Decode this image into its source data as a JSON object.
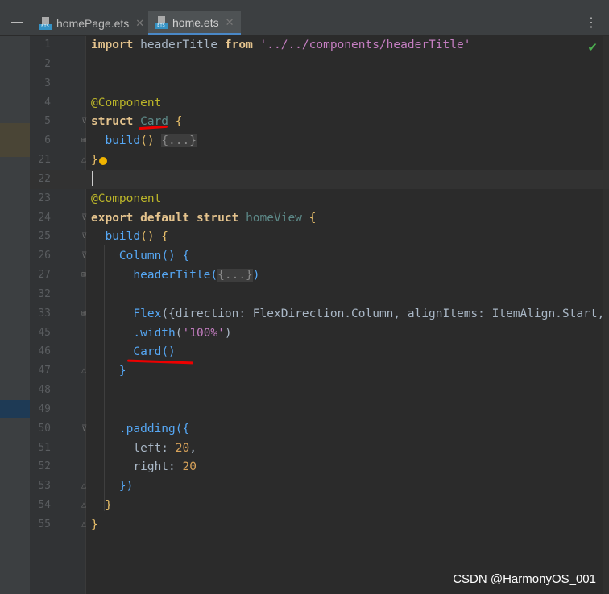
{
  "tabs": [
    {
      "label": "homePage.ets",
      "active": false
    },
    {
      "label": "home.ets",
      "active": true
    }
  ],
  "file_icon_label": "ETS",
  "status_icon": "check-icon",
  "watermark": "CSDN @HarmonyOS_001",
  "lines": [
    {
      "n": "1",
      "tokens": [
        [
          "import ",
          "kw"
        ],
        [
          "headerTitle ",
          ""
        ],
        [
          "from ",
          "kw"
        ],
        [
          "'../../components/headerTitle'",
          "str"
        ]
      ]
    },
    {
      "n": "2",
      "tokens": []
    },
    {
      "n": "3",
      "tokens": []
    },
    {
      "n": "4",
      "tokens": [
        [
          "@Component",
          "dec"
        ]
      ]
    },
    {
      "n": "5",
      "fold": "⊽",
      "tokens": [
        [
          "struct ",
          "kw"
        ],
        [
          "Card",
          "unused"
        ],
        [
          " {",
          "brace"
        ]
      ]
    },
    {
      "n": "6",
      "fold": "⊞",
      "tokens": [
        [
          "  build",
          "fn"
        ],
        [
          "() ",
          "brace"
        ],
        [
          "{...}",
          "fold-ph"
        ]
      ]
    },
    {
      "n": "21",
      "fold": "△",
      "tokens": [
        [
          "}",
          "brace"
        ]
      ]
    },
    {
      "n": "22",
      "current": true,
      "tokens": []
    },
    {
      "n": "23",
      "tokens": [
        [
          "@Component",
          "dec"
        ]
      ]
    },
    {
      "n": "24",
      "fold": "⊽",
      "tokens": [
        [
          "export default struct ",
          "kw"
        ],
        [
          "homeView",
          "unused"
        ],
        [
          " {",
          "brace"
        ]
      ]
    },
    {
      "n": "25",
      "fold": "⊽",
      "tokens": [
        [
          "  build",
          "fn"
        ],
        [
          "() {",
          "brace"
        ]
      ]
    },
    {
      "n": "26",
      "fold": "⊽",
      "tokens": [
        [
          "    Column",
          "fn"
        ],
        [
          "() {",
          "fn"
        ]
      ]
    },
    {
      "n": "27",
      "fold": "⊞",
      "tokens": [
        [
          "      headerTitle",
          "fn"
        ],
        [
          "(",
          "fn"
        ],
        [
          "{...}",
          "fold-ph"
        ],
        [
          ")",
          "fn"
        ]
      ]
    },
    {
      "n": "32",
      "tokens": []
    },
    {
      "n": "33",
      "fold": "⊞",
      "tokens": [
        [
          "      Flex",
          "fn"
        ],
        [
          "({",
          ""
        ],
        [
          "direction: FlexDirection.Column, alignItems: ItemAlign.Start,",
          ""
        ]
      ]
    },
    {
      "n": "45",
      "tokens": [
        [
          "      .width",
          "fn"
        ],
        [
          "(",
          ""
        ],
        [
          "'100%'",
          "str"
        ],
        [
          ")",
          ""
        ]
      ]
    },
    {
      "n": "46",
      "tokens": [
        [
          "      Card",
          "fn"
        ],
        [
          "()",
          "fn"
        ]
      ]
    },
    {
      "n": "47",
      "fold": "△",
      "tokens": [
        [
          "    }",
          "fn"
        ]
      ]
    },
    {
      "n": "48",
      "tokens": []
    },
    {
      "n": "49",
      "tokens": []
    },
    {
      "n": "50",
      "fold": "⊽",
      "tokens": [
        [
          "    .padding",
          "fn"
        ],
        [
          "({",
          "fn"
        ]
      ]
    },
    {
      "n": "51",
      "tokens": [
        [
          "      left: ",
          ""
        ],
        [
          "20",
          "num2"
        ],
        [
          ",",
          ""
        ]
      ]
    },
    {
      "n": "52",
      "tokens": [
        [
          "      right: ",
          ""
        ],
        [
          "20",
          "num2"
        ]
      ]
    },
    {
      "n": "53",
      "fold": "△",
      "tokens": [
        [
          "    })",
          "fn"
        ]
      ]
    },
    {
      "n": "54",
      "fold": "△",
      "tokens": [
        [
          "  }",
          "brace"
        ]
      ]
    },
    {
      "n": "55",
      "fold": "△",
      "tokens": [
        [
          "}",
          "brace"
        ]
      ]
    }
  ]
}
